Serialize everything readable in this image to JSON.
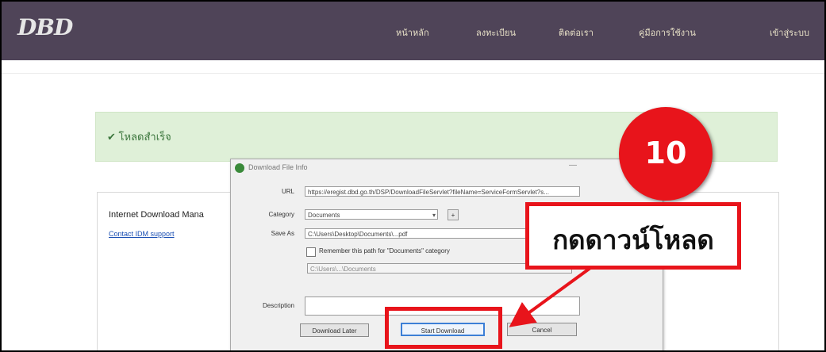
{
  "header": {
    "logo_text": "DBD",
    "nav_items": [
      "หน้าหลัก",
      "ลงทะเบียน",
      "ติดต่อเรา",
      "คู่มือการใช้งาน",
      "เข้าสู่ระบบ"
    ]
  },
  "alert": {
    "text": "✔ โหลดสำเร็จ"
  },
  "panel": {
    "title": "Internet Download Mana",
    "link": "Contact IDM support"
  },
  "dialog": {
    "title": "Download File Info",
    "minimize": "—",
    "url_label": "URL",
    "url_value": "https://eregist.dbd.go.th/DSP/DownloadFileServlet?fileName=ServiceFormServlet?s...",
    "category_label": "Category",
    "category_value": "Documents",
    "category_add": "+",
    "saveas_label": "Save As",
    "saveas_value": "C:\\Users\\Desktop\\Documents\\...pdf",
    "remember_label": "Remember this path for \"Documents\" category",
    "path_value": "C:\\Users\\...\\Documents",
    "description_label": "Description",
    "description_value": "",
    "download_later_label": "Download Later",
    "start_download_label": "Start Download",
    "cancel_label": "Cancel"
  },
  "annotation": {
    "step_number": "10",
    "callout_text": "กดดาวน์โหลด",
    "accent_color": "#e8141b"
  }
}
